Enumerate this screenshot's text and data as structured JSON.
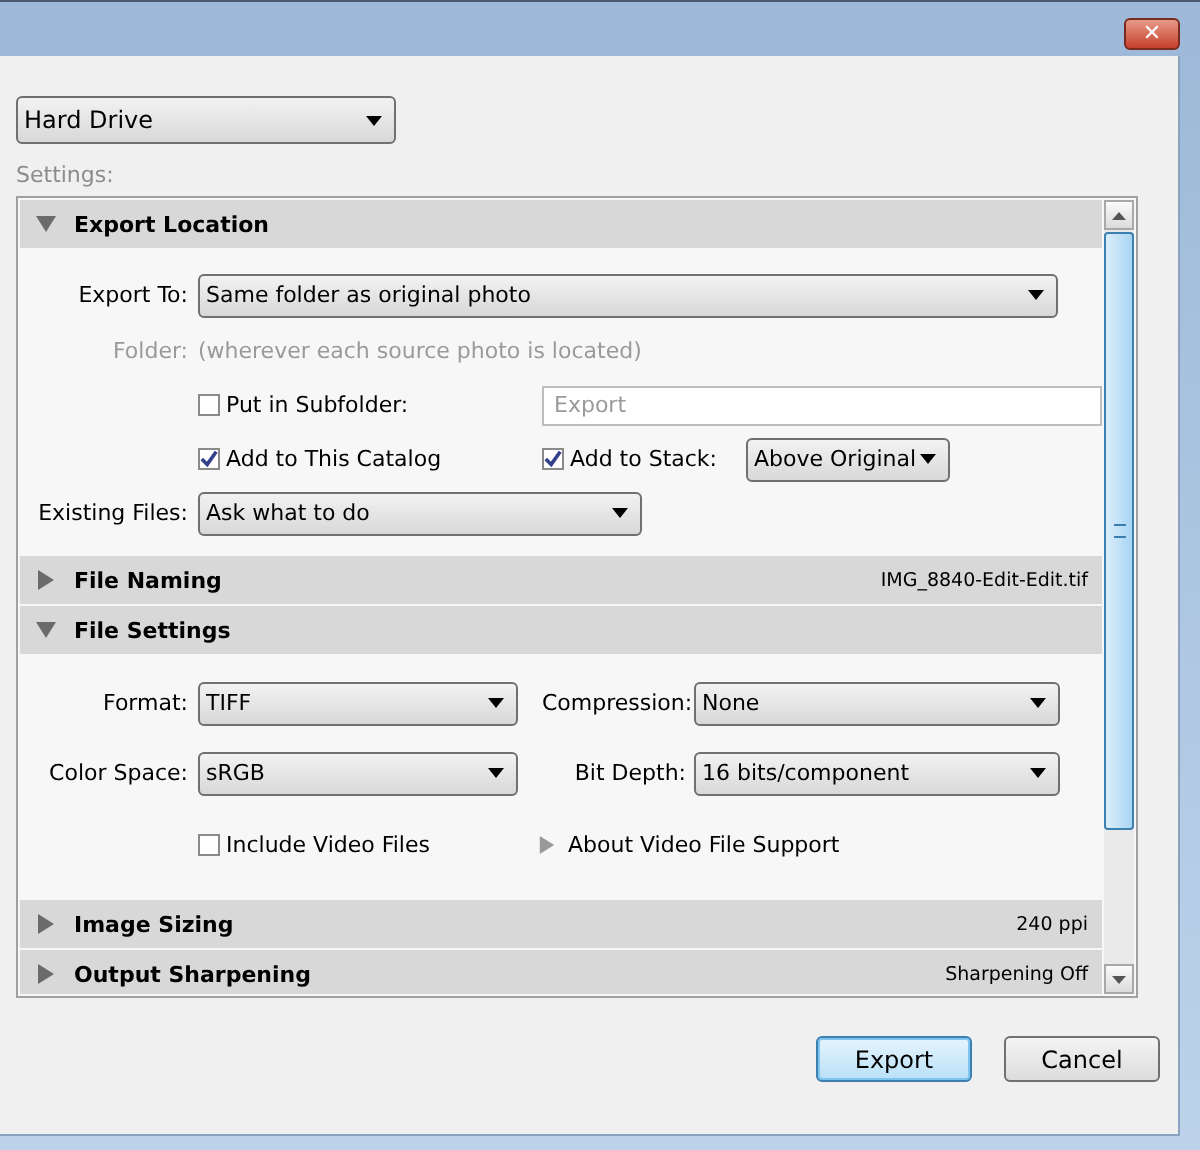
{
  "window": {
    "close": "✕"
  },
  "preset": {
    "value": "Hard Drive"
  },
  "settings_label": "Settings:",
  "sections": [
    {
      "title": "Export Location",
      "expanded": true,
      "kind": "location_form"
    },
    {
      "title": "File Naming",
      "expanded": false,
      "kind": "summary",
      "summary": "IMG_8840-Edit-Edit.tif"
    },
    {
      "title": "File Settings",
      "expanded": true,
      "kind": "file_form"
    },
    {
      "title": "Image Sizing",
      "expanded": false,
      "kind": "summary",
      "summary": "240 ppi"
    },
    {
      "title": "Output Sharpening",
      "expanded": false,
      "kind": "summary",
      "summary": "Sharpening Off"
    }
  ],
  "export_location": {
    "export_to": {
      "label": "Export To:",
      "value": "Same folder as original photo"
    },
    "folder": {
      "label": "Folder:",
      "value": "(wherever each source photo is located)",
      "disabled": true
    },
    "subfolder": {
      "label": "Put in Subfolder:",
      "checked": false,
      "value": "Export",
      "disabled": true
    },
    "add_to_catalog": {
      "label": "Add to This Catalog",
      "checked": true
    },
    "add_to_stack": {
      "label": "Add to Stack:",
      "checked": true,
      "value": "Above Original"
    },
    "existing_files": {
      "label": "Existing Files:",
      "value": "Ask what to do"
    }
  },
  "file_settings": {
    "format": {
      "label": "Format:",
      "value": "TIFF"
    },
    "compression": {
      "label": "Compression:",
      "value": "None"
    },
    "color_space": {
      "label": "Color Space:",
      "value": "sRGB"
    },
    "bit_depth": {
      "label": "Bit Depth:",
      "value": "16 bits/component"
    },
    "include_video": {
      "label": "Include Video Files",
      "checked": false
    },
    "about_video": {
      "label": "About Video File Support",
      "expanded": false
    }
  },
  "buttons": [
    {
      "label": "Export",
      "default": true
    },
    {
      "label": "Cancel",
      "default": false
    }
  ]
}
